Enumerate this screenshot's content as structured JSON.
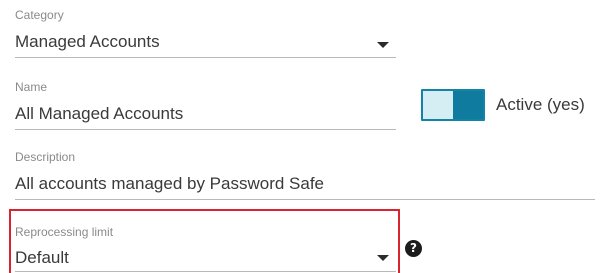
{
  "form": {
    "category": {
      "label": "Category",
      "value": "Managed Accounts"
    },
    "name": {
      "label": "Name",
      "value": "All Managed Accounts"
    },
    "active_toggle": {
      "label": "Active (yes)",
      "state": "on"
    },
    "description": {
      "label": "Description",
      "value": "All accounts managed by Password Safe"
    },
    "reprocessing_limit": {
      "label": "Reprocessing limit",
      "value": "Default",
      "help_icon": "question-circle-icon"
    }
  },
  "colors": {
    "highlight_border": "#d9232e",
    "toggle_on": "#0f7b9e",
    "toggle_track": "#d4eef4"
  }
}
